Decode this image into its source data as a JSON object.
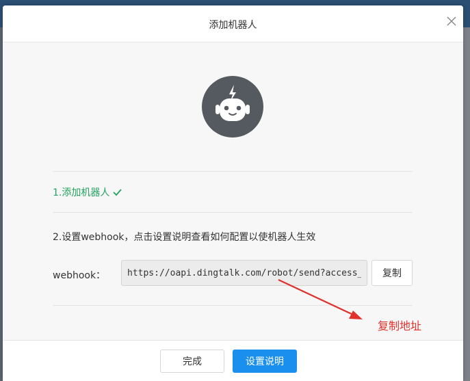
{
  "dialog": {
    "title": "添加机器人"
  },
  "steps": {
    "step1": "1.添加机器人",
    "step2": "2.设置webhook，点击设置说明查看如何配置以使机器人生效"
  },
  "webhook": {
    "label": "webhook：",
    "value": "https://oapi.dingtalk.com/robot/send?access_token=",
    "copy_label": "复制"
  },
  "annotation": {
    "text": "复制地址"
  },
  "footer": {
    "done_label": "完成",
    "help_label": "设置说明"
  },
  "colors": {
    "primary": "#1a8fee",
    "success": "#23a35e",
    "annotation": "#e0322b",
    "avatar": "#555a60"
  },
  "icons": {
    "close": "close-icon",
    "robot": "robot-icon",
    "check": "check-icon"
  }
}
